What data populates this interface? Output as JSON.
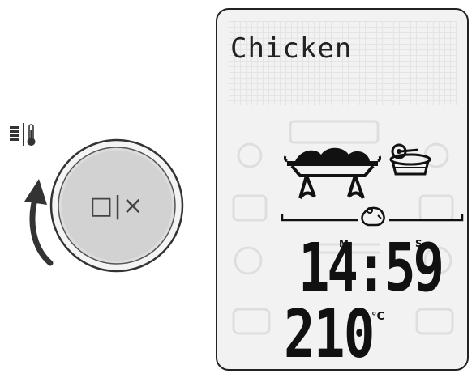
{
  "controls": {
    "mode_icons": [
      "level-bars-icon",
      "thermometer-icon"
    ],
    "rotate_arrow": "curved-arrow-up-icon",
    "knob_label": "□|×"
  },
  "display": {
    "program_name": "Chicken",
    "time_label_minutes": "M",
    "time_label_seconds": "S",
    "time": "14:59",
    "temperature": "210",
    "temperature_unit": "°C",
    "icons": [
      "grill-rack-icon",
      "covered-dish-icon",
      "poultry-icon"
    ]
  }
}
